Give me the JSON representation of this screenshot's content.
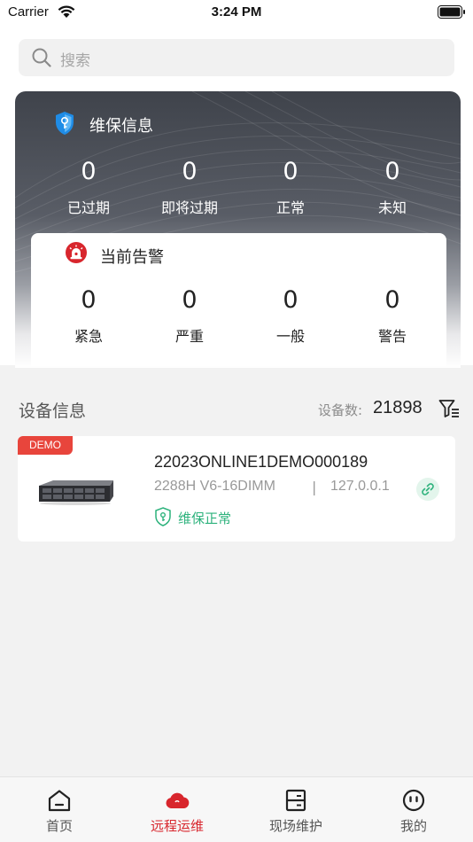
{
  "status_bar": {
    "carrier": "Carrier",
    "time": "3:24 PM"
  },
  "search": {
    "placeholder": "搜索"
  },
  "warranty": {
    "title": "维保信息",
    "stats": [
      {
        "value": "0",
        "label": "已过期"
      },
      {
        "value": "0",
        "label": "即将过期"
      },
      {
        "value": "0",
        "label": "正常"
      },
      {
        "value": "0",
        "label": "未知"
      }
    ]
  },
  "alarms": {
    "title": "当前告警",
    "stats": [
      {
        "value": "0",
        "label": "紧急"
      },
      {
        "value": "0",
        "label": "严重"
      },
      {
        "value": "0",
        "label": "一般"
      },
      {
        "value": "0",
        "label": "警告"
      }
    ]
  },
  "devices": {
    "title": "设备信息",
    "count_label": "设备数:",
    "count": "21898",
    "items": [
      {
        "badge": "DEMO",
        "name": "22023ONLINE1DEMO000189",
        "model": "2288H V6-16DIMM",
        "separator": "|",
        "ip": "127.0.0.1",
        "status": "维保正常"
      }
    ]
  },
  "nav": {
    "items": [
      {
        "label": "首页",
        "icon": "home-icon"
      },
      {
        "label": "远程运维",
        "icon": "cloud-icon"
      },
      {
        "label": "现场维护",
        "icon": "server-rack-icon"
      },
      {
        "label": "我的",
        "icon": "face-icon"
      }
    ],
    "active_index": 1
  },
  "colors": {
    "accent": "#d8262d",
    "ok": "#2db27c",
    "badge": "#e8453c",
    "link": "#1e88e5"
  }
}
